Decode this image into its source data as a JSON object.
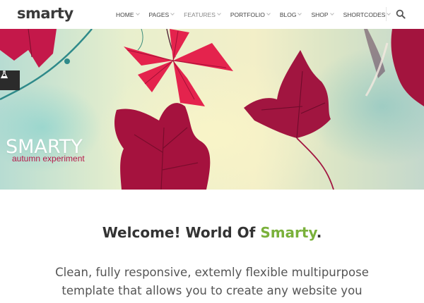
{
  "header": {
    "logo": "smarty",
    "nav": [
      {
        "label": "HOME"
      },
      {
        "label": "PAGES"
      },
      {
        "label": "FEATURES"
      },
      {
        "label": "PORTFOLIO"
      },
      {
        "label": "BLOG"
      },
      {
        "label": "SHOP"
      },
      {
        "label": "SHORTCODES"
      }
    ],
    "active_nav": "FEATURES",
    "search_icon": "search-icon"
  },
  "hero": {
    "title": "SMARTY",
    "subtitle": "autumn experiment",
    "side_icon": "flask-icon",
    "leaf_color": "#b0153f"
  },
  "content": {
    "welcome_prefix": "Welcome! World Of ",
    "welcome_accent": "Smarty",
    "welcome_suffix": ".",
    "accent_color": "#7ab13b",
    "intro_line1": "Clean, fully responsive, extemly flexible multipurpose",
    "intro_line2": "template that allows you to create any website you"
  }
}
